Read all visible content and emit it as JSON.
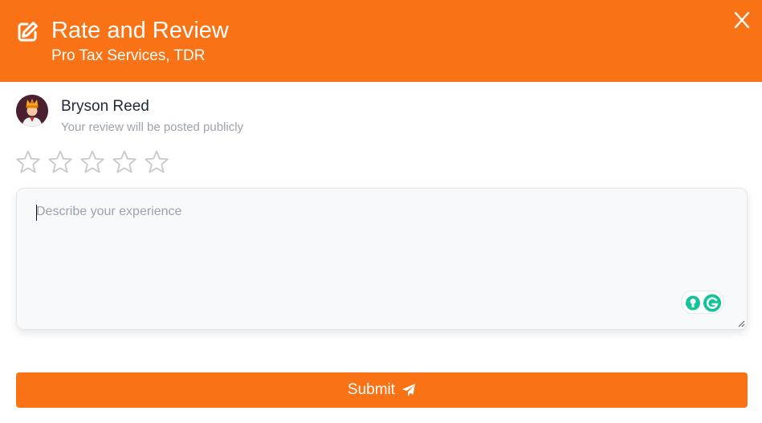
{
  "header": {
    "title": "Rate and Review",
    "subtitle": "Pro Tax Services, TDR",
    "close_label": "X",
    "background": "#f97316"
  },
  "user": {
    "name": "Bryson Reed",
    "note": "Your review will be posted publicly",
    "avatar_icon": "crowned-person-avatar"
  },
  "rating": {
    "max_stars": 5,
    "selected": 0,
    "star_icon": "star-outline-icon"
  },
  "review": {
    "placeholder": "Describe your experience",
    "value": ""
  },
  "submit": {
    "label": "Submit",
    "icon": "paper-plane-icon",
    "background": "#f97316"
  }
}
